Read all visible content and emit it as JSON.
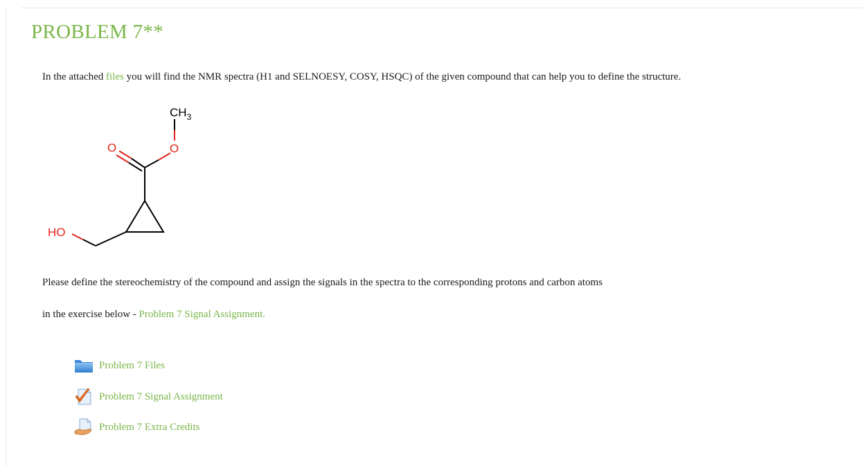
{
  "title": "PROBLEM 7**",
  "intro": {
    "before": "In the attached ",
    "link": "files",
    "after": " you will find the NMR spectra (H1 and SELNOESY, COSY, HSQC) of the given compound that can help you to define the structure."
  },
  "molecule": {
    "label_ch3_main": "CH",
    "label_ch3_sub": "3",
    "label_o_ester": "O",
    "label_o_carbonyl": "O",
    "label_ho": "HO",
    "colors": {
      "bond": "#000000",
      "oxygen": "#e2231a"
    }
  },
  "instruction_line1": "Please define the stereochemistry of the compound and assign the signals in the spectra to the corresponding protons and carbon atoms",
  "instruction_line2": {
    "before": "in the exercise below  - ",
    "link": "Problem 7 Signal Assignment."
  },
  "activities": [
    {
      "label": "Problem 7 Files",
      "icon": "folder-icon"
    },
    {
      "label": "Problem 7 Signal Assignment",
      "icon": "assignment-check-icon"
    },
    {
      "label": "Problem 7 Extra Credits",
      "icon": "hand-document-icon"
    }
  ],
  "colors": {
    "accent": "#7ab648",
    "text": "#1a1a1a"
  }
}
